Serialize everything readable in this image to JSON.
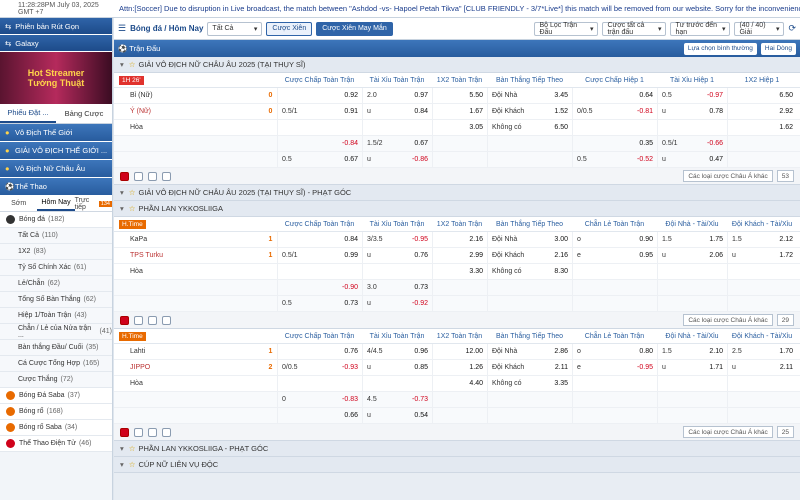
{
  "topbar": {
    "time": "11:28:28PM July 03, 2025 GMT +7",
    "notice": "Attn:[Soccer] Due to disruption in Live broadcast, the match between \"Ashdod -vs- Hapoel Petah Tikva\" [CLUB FRIENDLY - 3/7*Live*] this match will be removed from our website. Sorry for the inconvenience caused!"
  },
  "sidebar": {
    "btn1": "Phiên bản Rút Gọn",
    "btn2": "Galaxy",
    "banner_l1": "Hot Streamer",
    "banner_l2": "Tướng Thuật",
    "tab1": "Phiếu Đặt ...",
    "tab2": "Bảng Cược",
    "heads": [
      "Vô Địch Thế Giới",
      "GIẢI VÔ ĐỊCH THẾ GIỚI ...",
      "Vô Địch Nữ Châu Âu"
    ],
    "sports_head": "Thể Thao",
    "sub_tabs": [
      "Sớm",
      "Hôm Nay",
      "Trực tiếp"
    ],
    "live_count": "134",
    "football": {
      "label": "Bóng đá",
      "count": "(182)"
    },
    "items": [
      {
        "label": "Tất Cả",
        "count": "(110)"
      },
      {
        "label": "1X2",
        "count": "(83)"
      },
      {
        "label": "Tỷ Số Chính Xác",
        "count": "(61)"
      },
      {
        "label": "Lẻ/Chẵn",
        "count": "(62)"
      },
      {
        "label": "Tổng Số Bàn Thắng",
        "count": "(62)"
      },
      {
        "label": "Hiệp 1/Toàn Trận",
        "count": "(43)"
      },
      {
        "label": "Chẵn / Lẻ của Nửa trận ...",
        "count": "(41)"
      },
      {
        "label": "Bàn thắng Đầu/ Cuối",
        "count": "(35)"
      },
      {
        "label": "Cá Cược Tổng Hợp",
        "count": "(165)"
      },
      {
        "label": "Cược Thắng",
        "count": "(72)"
      }
    ],
    "others": [
      {
        "label": "Bóng Đá Saba",
        "count": "(37)"
      },
      {
        "label": "Bóng rổ",
        "count": "(168)"
      },
      {
        "label": "Bóng rổ Saba",
        "count": "(34)"
      },
      {
        "label": "Thể Thao Điện Tử",
        "count": "(46)"
      }
    ]
  },
  "toolbar": {
    "title": "Bóng đá / Hôm Nay",
    "filter": "Tất Cả",
    "btn_parlay": "Cược Xiên",
    "btn_lucky": "Cược Xiên May Mắn",
    "league_filter": "Bộ Lọc Trận Đấu",
    "multi_odds": "Cược tất cả trận đấu",
    "sort": "Tư trước đến hạn",
    "pages": "(40 / 40) Giải"
  },
  "section": {
    "title": "Trận Đấu",
    "sort_btn": "Lựa chọn bình thường",
    "view_btn": "Hai Dòng"
  },
  "leagues": [
    {
      "name": "GIẢI VÔ ĐỊCH NỮ CHÂU ÂU 2025 (TẠI THỤY SĨ)",
      "live": "1H 26'",
      "cols": [
        "Cược Chấp Toàn Trận",
        "Tài Xỉu Toàn Trận",
        "1X2 Toàn Trận",
        "Bàn Thắng Tiếp Theo",
        "Cược Chấp Hiệp 1",
        "Tài Xỉu Hiệp 1",
        "1X2 Hiệp 1"
      ],
      "rows": [
        {
          "team": "Bỉ (Nữ)",
          "score": "0",
          "c": [
            [
              "",
              "0.92"
            ],
            [
              "2.0",
              "0.97"
            ],
            [
              "",
              "5.50"
            ],
            [
              "Đội Nhà",
              "3.45"
            ],
            [
              "",
              "0.64"
            ],
            [
              "0.5",
              "-0.97"
            ],
            [
              "",
              "6.50"
            ]
          ]
        },
        {
          "team": "Ý (Nữ)",
          "score": "0",
          "fav": true,
          "c": [
            [
              "0.5/1",
              "0.91"
            ],
            [
              "u",
              "0.84"
            ],
            [
              "",
              "1.67"
            ],
            [
              "Đội Khách",
              "1.52"
            ],
            [
              "0/0.5",
              "-0.81"
            ],
            [
              "u",
              "0.78"
            ],
            [
              "",
              "2.92"
            ]
          ]
        },
        {
          "team": "Hòa",
          "score": "",
          "c": [
            [
              "",
              ""
            ],
            [
              "",
              ""
            ],
            [
              "",
              "3.05"
            ],
            [
              "Không có",
              "6.50"
            ],
            [
              "",
              ""
            ],
            [
              "",
              ""
            ],
            [
              "",
              "1.62"
            ]
          ]
        },
        {
          "team": "",
          "score": "",
          "c": [
            [
              "",
              "-0.84"
            ],
            [
              "1.5/2",
              "0.67"
            ],
            [
              "",
              ""
            ],
            [
              "",
              ""
            ],
            [
              "",
              "0.35"
            ],
            [
              "0.5/1",
              "-0.66"
            ],
            [
              "",
              ""
            ]
          ]
        },
        {
          "team": "",
          "score": "",
          "c": [
            [
              "0.5",
              "0.67"
            ],
            [
              "u",
              "-0.86"
            ],
            [
              "",
              ""
            ],
            [
              "",
              ""
            ],
            [
              "0.5",
              "-0.52"
            ],
            [
              "u",
              "0.47"
            ],
            [
              "",
              ""
            ]
          ]
        }
      ],
      "foot_sel": "Các loại cược Châu Á khác",
      "foot_num": "53"
    },
    {
      "name": "GIẢI VÔ ĐỊCH NỮ CHÂU ÂU 2025 (TẠI THỤY SĨ) - PHẠT GÓC",
      "collapsed": true
    },
    {
      "name": "PHẦN LAN YKKOSLIIGA",
      "live": "H.Time",
      "cols": [
        "Cược Chấp Toàn Trận",
        "Tài Xỉu Toàn Trận",
        "1X2 Toàn Trận",
        "Bàn Thắng Tiếp Theo",
        "Chẵn Lẻ Toàn Trận",
        "Đội Nhà - Tài/Xỉu",
        "Đội Khách - Tài/Xỉu"
      ],
      "rows": [
        {
          "team": "KaPa",
          "score": "1",
          "c": [
            [
              "",
              "0.84"
            ],
            [
              "3/3.5",
              "-0.95"
            ],
            [
              "",
              "2.16"
            ],
            [
              "Đội Nhà",
              "3.00"
            ],
            [
              "o",
              "0.90"
            ],
            [
              "1.5",
              "1.75"
            ],
            [
              "1.5",
              "2.12"
            ]
          ]
        },
        {
          "team": "TPS Turku",
          "score": "1",
          "fav": true,
          "c": [
            [
              "0.5/1",
              "0.99"
            ],
            [
              "u",
              "0.76"
            ],
            [
              "",
              "2.99"
            ],
            [
              "Đội Khách",
              "2.16"
            ],
            [
              "e",
              "0.95"
            ],
            [
              "u",
              "2.06"
            ],
            [
              "u",
              "1.72"
            ]
          ]
        },
        {
          "team": "Hòa",
          "score": "",
          "c": [
            [
              "",
              ""
            ],
            [
              "",
              ""
            ],
            [
              "",
              "3.30"
            ],
            [
              "Không có",
              "8.30"
            ],
            [
              "",
              ""
            ],
            [
              "",
              ""
            ],
            [
              "",
              ""
            ]
          ]
        },
        {
          "team": "",
          "score": "",
          "c": [
            [
              "",
              "-0.90"
            ],
            [
              "3.0",
              "0.73"
            ],
            [
              "",
              ""
            ],
            [
              "",
              ""
            ],
            [
              "",
              ""
            ],
            [
              "",
              ""
            ],
            [
              "",
              ""
            ]
          ]
        },
        {
          "team": "",
          "score": "",
          "c": [
            [
              "0.5",
              "0.73"
            ],
            [
              "u",
              "-0.92"
            ],
            [
              "",
              ""
            ],
            [
              "",
              ""
            ],
            [
              "",
              ""
            ],
            [
              "",
              ""
            ],
            [
              "",
              ""
            ]
          ]
        }
      ],
      "foot_sel": "Các loại cược Châu Á khác",
      "foot_num": "29"
    },
    {
      "name": "",
      "live": "H.Time",
      "cols": [
        "Cược Chấp Toàn Trận",
        "Tài Xỉu Toàn Trận",
        "1X2 Toàn Trận",
        "Bàn Thắng Tiếp Theo",
        "Chẵn Lẻ Toàn Trận",
        "Đội Nhà - Tài/Xỉu",
        "Đội Khách - Tài/Xỉu"
      ],
      "rows": [
        {
          "team": "Lahti",
          "score": "1",
          "card": "1",
          "c": [
            [
              "",
              "0.76"
            ],
            [
              "4/4.5",
              "0.96"
            ],
            [
              "",
              "12.00"
            ],
            [
              "Đội Nhà",
              "2.86"
            ],
            [
              "o",
              "0.80"
            ],
            [
              "1.5",
              "2.10"
            ],
            [
              "2.5",
              "1.70"
            ]
          ]
        },
        {
          "team": "JIPPO",
          "score": "2",
          "fav": true,
          "c": [
            [
              "0/0.5",
              "-0.93"
            ],
            [
              "u",
              "0.85"
            ],
            [
              "",
              "1.26"
            ],
            [
              "Đội Khách",
              "2.11"
            ],
            [
              "e",
              "-0.95"
            ],
            [
              "u",
              "1.71"
            ],
            [
              "u",
              "2.11"
            ]
          ]
        },
        {
          "team": "Hòa",
          "score": "",
          "c": [
            [
              "",
              ""
            ],
            [
              "",
              ""
            ],
            [
              "",
              "4.40"
            ],
            [
              "Không có",
              "3.35"
            ],
            [
              "",
              ""
            ],
            [
              "",
              ""
            ],
            [
              "",
              ""
            ]
          ]
        },
        {
          "team": "",
          "score": "",
          "c": [
            [
              "0",
              "-0.83"
            ],
            [
              "4.5",
              "-0.73"
            ],
            [
              "",
              ""
            ],
            [
              "",
              ""
            ],
            [
              "",
              ""
            ],
            [
              "",
              ""
            ],
            [
              "",
              ""
            ]
          ]
        },
        {
          "team": "",
          "score": "",
          "c": [
            [
              "",
              "0.66"
            ],
            [
              "u",
              "0.54"
            ],
            [
              "",
              ""
            ],
            [
              "",
              ""
            ],
            [
              "",
              ""
            ],
            [
              "",
              ""
            ],
            [
              "",
              ""
            ]
          ]
        }
      ],
      "foot_sel": "Các loại cược Châu Á khác",
      "foot_num": "25"
    },
    {
      "name": "PHẦN LAN YKKOSLIIGA - PHẠT GÓC",
      "collapsed": true
    },
    {
      "name": "CÚP NỮ LIÊN VỤ ĐỘC",
      "collapsed": true
    }
  ]
}
